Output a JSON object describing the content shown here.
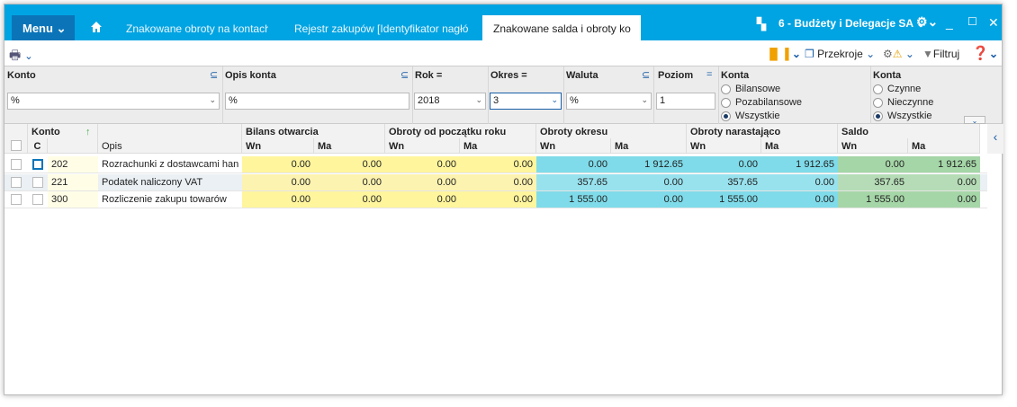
{
  "titlebar": {
    "menu": "Menu",
    "tabs": [
      "Znakowane obroty na kontach",
      "Rejestr zakupów [Identyfikator nagłó",
      "Znakowane salda i obroty ko"
    ],
    "company": "6 - Budżety i Delegacje SA"
  },
  "toolbar": {
    "przekroje": "Przekroje",
    "filtruj": "Filtruj"
  },
  "filters": {
    "konto_label": "Konto",
    "konto_value": "%",
    "opis_label": "Opis konta",
    "opis_value": "%",
    "rok_label": "Rok =",
    "rok_value": "2018",
    "okres_label": "Okres =",
    "okres_value": "3",
    "waluta_label": "Waluta",
    "waluta_value": "%",
    "poziom_label": "Poziom",
    "poziom_value": "1",
    "konta1": {
      "label": "Konta",
      "options": [
        "Bilansowe",
        "Pozabilansowe",
        "Wszystkie"
      ],
      "selected": 2
    },
    "konta2": {
      "label": "Konta",
      "options": [
        "Czynne",
        "Nieczynne",
        "Wszystkie"
      ],
      "selected": 2
    }
  },
  "grid": {
    "h_konto": "Konto",
    "h_c": "C",
    "h_opis": "Opis",
    "groups": [
      "Bilans otwarcia",
      "Obroty od początku roku",
      "Obroty okresu",
      "Obroty narastająco",
      "Saldo"
    ],
    "wn": "Wn",
    "ma": "Ma",
    "rows": [
      {
        "konto": "202",
        "opis": "Rozrachunki z dostawcami han",
        "values": [
          "0.00",
          "0.00",
          "0.00",
          "0.00",
          "0.00",
          "1 912.65",
          "0.00",
          "1 912.65",
          "0.00",
          "1 912.65"
        ]
      },
      {
        "konto": "221",
        "opis": "Podatek naliczony VAT",
        "values": [
          "0.00",
          "0.00",
          "0.00",
          "0.00",
          "357.65",
          "0.00",
          "357.65",
          "0.00",
          "357.65",
          "0.00"
        ]
      },
      {
        "konto": "300",
        "opis": "Rozliczenie zakupu towarów",
        "values": [
          "0.00",
          "0.00",
          "0.00",
          "0.00",
          "1 555.00",
          "0.00",
          "1 555.00",
          "0.00",
          "1 555.00",
          "0.00"
        ]
      }
    ]
  },
  "colors": {
    "titlebar": "#01a4e2",
    "yellow": "#fff59d",
    "cyan": "#7fdbe9",
    "green": "#a5d6a7"
  }
}
